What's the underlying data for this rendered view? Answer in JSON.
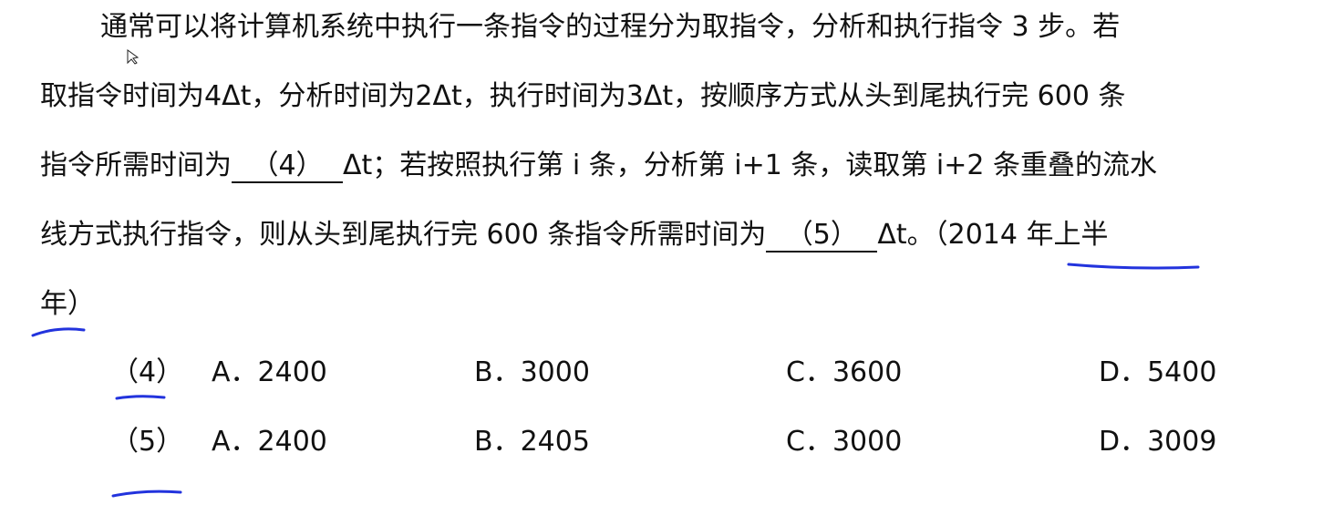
{
  "question": {
    "line1": "通常可以将计算机系统中执行一条指令的过程分为取指令，分析和执行指令 3 步。若",
    "line2": "取指令时间为4Δt，分析时间为2Δt，执行时间为3Δt，按顺序方式从头到尾执行完 600 条",
    "line3_pre": "指令所需时间为",
    "blank4": "（4）",
    "line3_post": "Δt；若按照执行第 i 条，分析第 i+1 条，读取第 i+2 条重叠的流水",
    "line4_pre": "线方式执行指令，则从头到尾执行完 600 条指令所需时间为",
    "blank5": "（5）",
    "line4_post": "Δt。（2014 年上半",
    "line5": "年）"
  },
  "options": [
    {
      "num": "（4）",
      "a": "A．2400",
      "b": "B．3000",
      "c": "C．3600",
      "d": "D．5400"
    },
    {
      "num": "（5）",
      "a": "A．2400",
      "b": "B．2405",
      "c": "C．3000",
      "d": "D．3009"
    }
  ],
  "colors": {
    "annotation": "#2233dd",
    "text": "#111111"
  }
}
